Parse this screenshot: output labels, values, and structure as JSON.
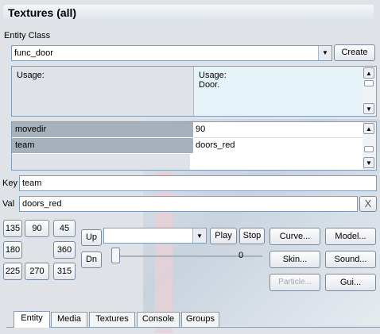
{
  "window": {
    "title": "Textures (all)"
  },
  "entity_class": {
    "label": "Entity Class",
    "value": "func_door",
    "create_label": "Create"
  },
  "usage": {
    "left_label": "Usage:",
    "right_title": "Usage:",
    "right_text": "Door."
  },
  "keyvalues": [
    {
      "key": "movedir",
      "value": "90"
    },
    {
      "key": "team",
      "value": "doors_red"
    }
  ],
  "key_field": {
    "label": "Key",
    "value": "team"
  },
  "val_field": {
    "label": "Val",
    "value": "doors_red",
    "clear_glyph": "X"
  },
  "angles": [
    "135",
    "90",
    "45",
    "180",
    "360",
    "225",
    "270",
    "315"
  ],
  "updown": {
    "up": "Up",
    "down": "Dn"
  },
  "sound": {
    "play": "Play",
    "stop": "Stop",
    "slider_value": "0"
  },
  "right_buttons": {
    "curve": "Curve...",
    "model": "Model...",
    "skin": "Skin...",
    "sound": "Sound...",
    "particle": "Particle...",
    "gui": "Gui..."
  },
  "tabs": [
    "Entity",
    "Media",
    "Textures",
    "Console",
    "Groups"
  ],
  "colors": {
    "panel": "#dfe3e8",
    "key_highlight": "#a6b1bc",
    "input_border": "#7f9db9"
  }
}
